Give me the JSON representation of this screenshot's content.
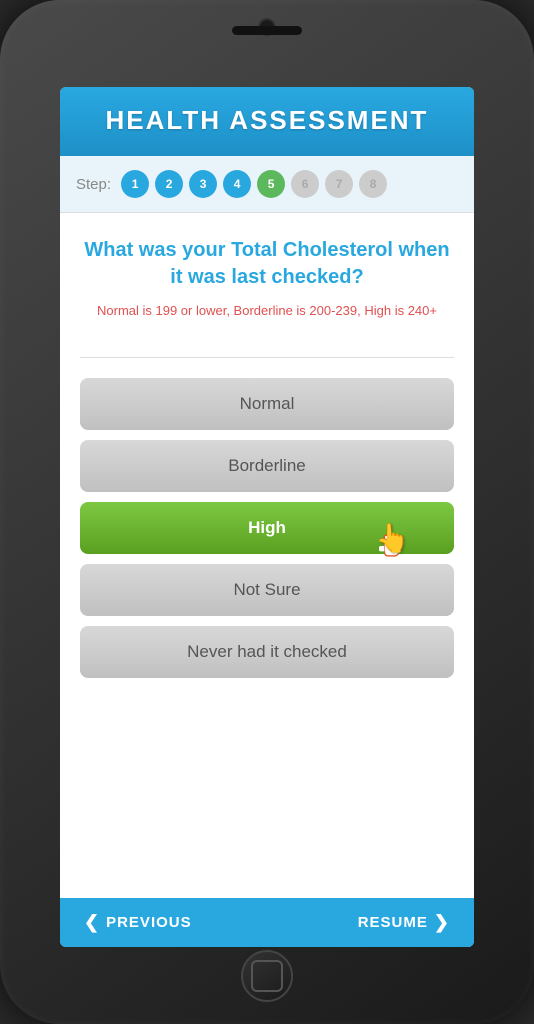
{
  "phone": {
    "speaker_aria": "speaker"
  },
  "header": {
    "title": "HEALTH ASSESSMENT"
  },
  "steps": {
    "label": "Step:",
    "items": [
      {
        "number": "1",
        "state": "completed"
      },
      {
        "number": "2",
        "state": "completed"
      },
      {
        "number": "3",
        "state": "completed"
      },
      {
        "number": "4",
        "state": "completed"
      },
      {
        "number": "5",
        "state": "active"
      },
      {
        "number": "6",
        "state": "inactive"
      },
      {
        "number": "7",
        "state": "inactive"
      },
      {
        "number": "8",
        "state": "inactive"
      }
    ]
  },
  "question": {
    "main": "What was your Total Cholesterol when it was last checked?",
    "hint": "Normal is 199 or lower, Borderline is 200-239, High is 240+"
  },
  "options": [
    {
      "label": "Normal",
      "state": "normal",
      "key": "normal"
    },
    {
      "label": "Borderline",
      "state": "borderline",
      "key": "borderline"
    },
    {
      "label": "High",
      "state": "high",
      "key": "high"
    },
    {
      "label": "Not Sure",
      "state": "not-sure",
      "key": "not-sure"
    },
    {
      "label": "Never had it checked",
      "state": "never",
      "key": "never"
    }
  ],
  "bottom_nav": {
    "previous_label": "PREVIOUS",
    "previous_arrow": "❮",
    "resume_label": "RESUME",
    "resume_arrow": "❯"
  }
}
